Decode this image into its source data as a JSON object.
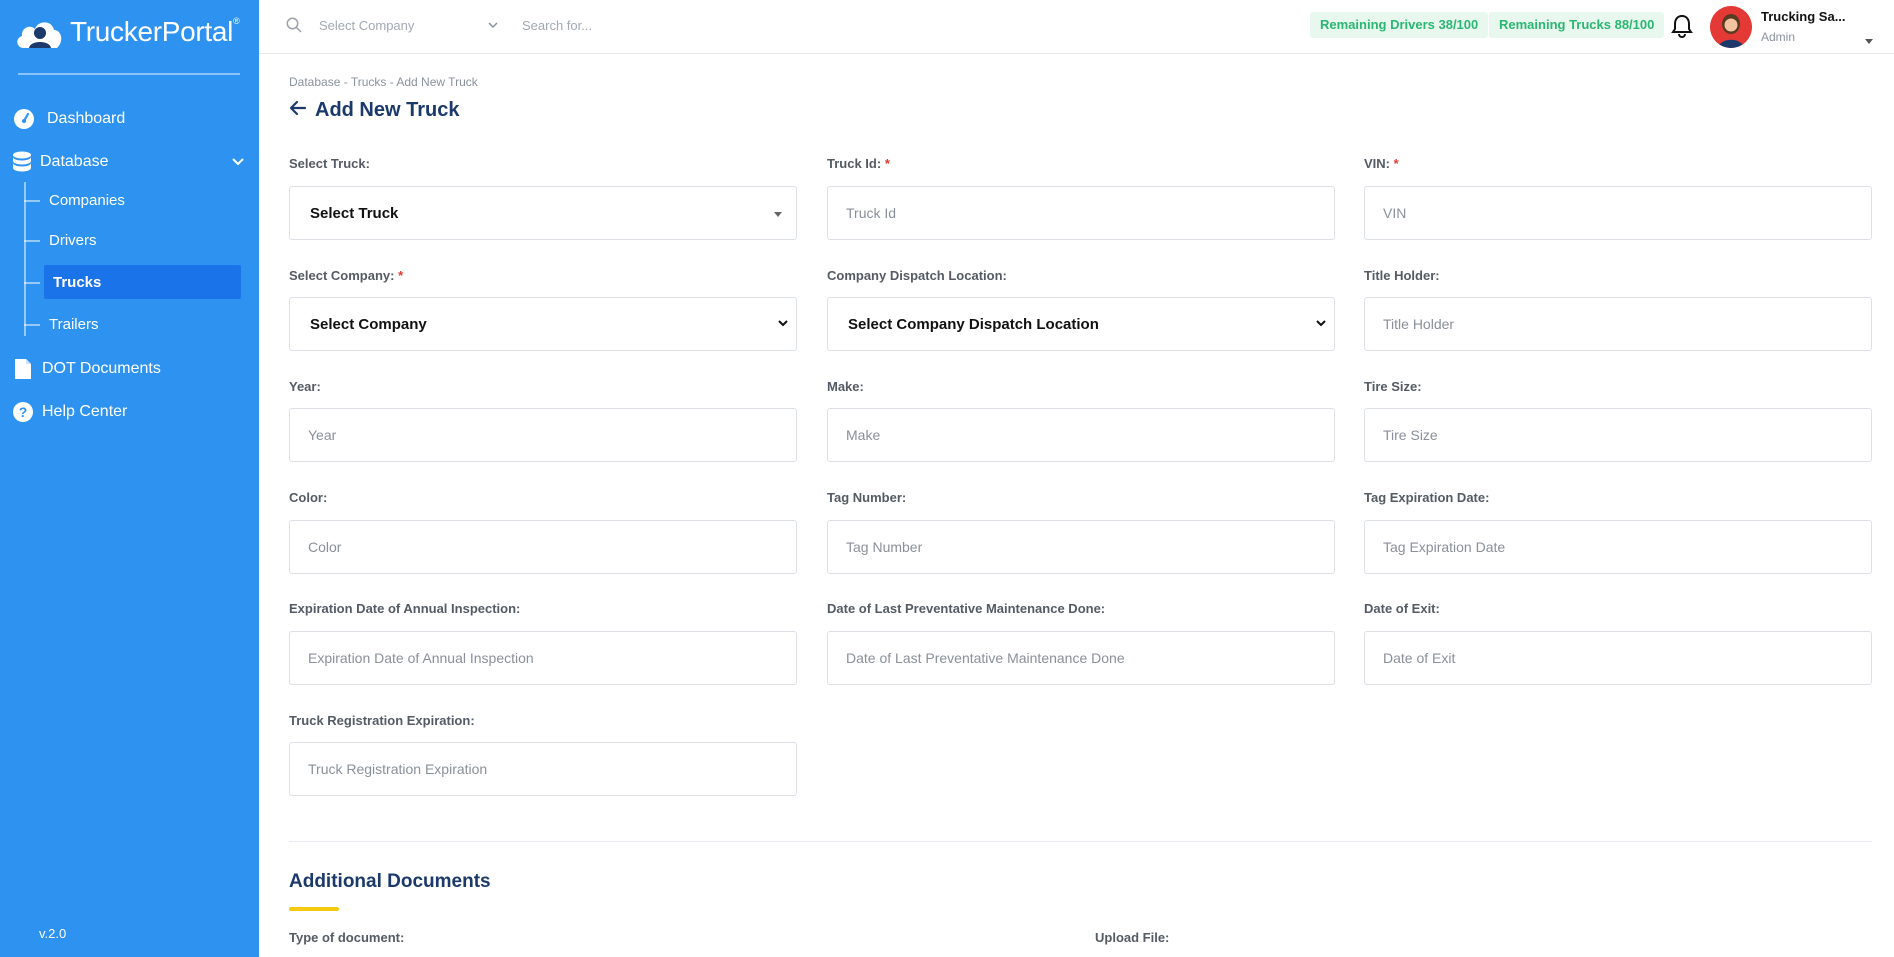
{
  "app": {
    "logo_text": "TruckerPortal",
    "version": "v.2.0",
    "accent_color": "#2e93f0",
    "active_color": "#1a73e8"
  },
  "sidebar": {
    "items": [
      {
        "label": "Dashboard",
        "icon": "dashboard-gauge-icon"
      },
      {
        "label": "Database",
        "icon": "database-icon"
      },
      {
        "label": "DOT Documents",
        "icon": "document-icon"
      },
      {
        "label": "Help Center",
        "icon": "help-circle-icon"
      }
    ],
    "sub_items": [
      {
        "label": "Companies"
      },
      {
        "label": "Drivers"
      },
      {
        "label": "Trucks",
        "active": true
      },
      {
        "label": "Trailers"
      }
    ]
  },
  "header": {
    "company_placeholder": "Select Company",
    "search_placeholder": "Search for...",
    "remaining_drivers": "Remaining Drivers 38/100",
    "remaining_trucks": "Remaining Trucks 88/100",
    "user_name": "Trucking Sa...",
    "user_role": "Admin"
  },
  "page": {
    "breadcrumb": "Database - Trucks - Add New Truck",
    "title": "Add New Truck"
  },
  "form": {
    "select_truck": {
      "label": "Select Truck:",
      "value": "Select Truck"
    },
    "truck_id": {
      "label": "Truck Id:",
      "required": "*",
      "placeholder": "Truck Id"
    },
    "vin": {
      "label": "VIN:",
      "required": "*",
      "placeholder": "VIN"
    },
    "select_company": {
      "label": "Select Company:",
      "required": "*",
      "value": "Select Company"
    },
    "dispatch_location": {
      "label": "Company Dispatch Location:",
      "value": "Select Company Dispatch Location"
    },
    "title_holder": {
      "label": "Title Holder:",
      "placeholder": "Title Holder"
    },
    "year": {
      "label": "Year:",
      "placeholder": "Year"
    },
    "make": {
      "label": "Make:",
      "placeholder": "Make"
    },
    "tire_size": {
      "label": "Tire Size:",
      "placeholder": "Tire Size"
    },
    "color": {
      "label": "Color:",
      "placeholder": "Color"
    },
    "tag_number": {
      "label": "Tag Number:",
      "placeholder": "Tag Number"
    },
    "tag_expiration": {
      "label": "Tag Expiration Date:",
      "placeholder": "Tag Expiration Date"
    },
    "annual_inspection": {
      "label": "Expiration Date of Annual Inspection:",
      "placeholder": "Expiration Date of Annual Inspection"
    },
    "last_maintenance": {
      "label": "Date of Last Preventative Maintenance Done:",
      "placeholder": "Date of Last Preventative Maintenance Done"
    },
    "date_of_exit": {
      "label": "Date of Exit:",
      "placeholder": "Date of Exit"
    },
    "registration_expiration": {
      "label": "Truck Registration Expiration:",
      "placeholder": "Truck Registration Expiration"
    }
  },
  "documents": {
    "title": "Additional Documents",
    "type_label": "Type of document:",
    "upload_label": "Upload File:"
  }
}
